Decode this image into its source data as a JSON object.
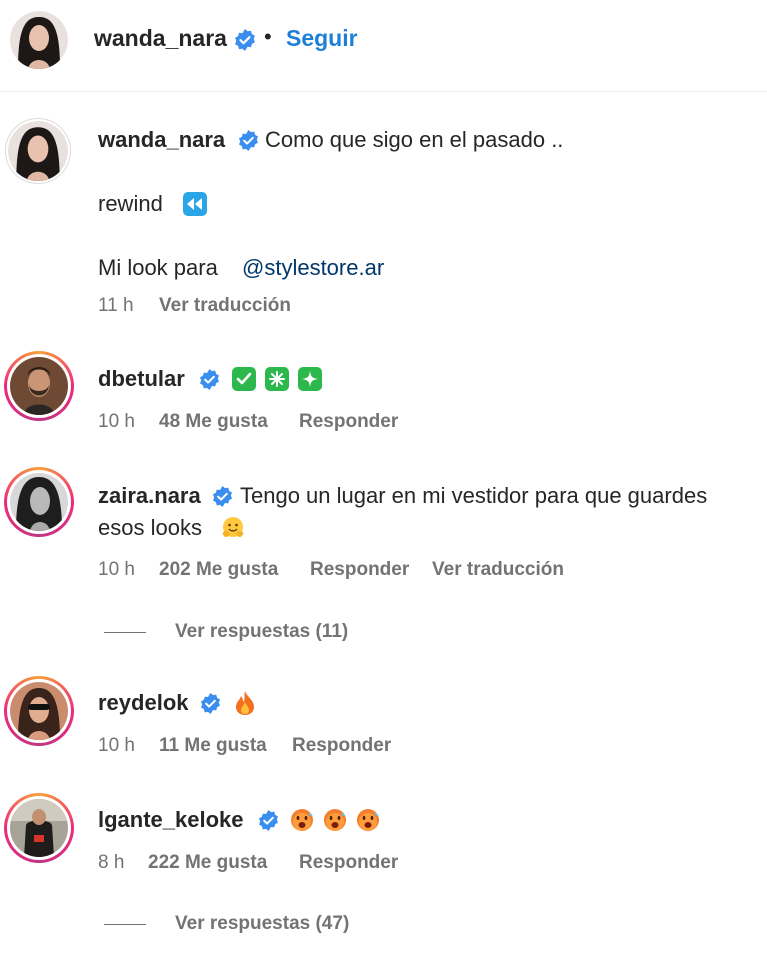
{
  "header": {
    "username": "wanda_nara",
    "separator": "•",
    "follow_label": "Seguir"
  },
  "caption": {
    "username": "wanda_nara",
    "line1": "Como que sigo en el pasado ..",
    "line2": "rewind",
    "line3_prefix": "Mi look para",
    "mention": "@stylestore.ar",
    "time": "11 h",
    "translate": "Ver traducción"
  },
  "comments": [
    {
      "username": "dbetular",
      "text": "",
      "emojis": [
        "check-mark-button",
        "eight-spoked-asterisk",
        "sparkle"
      ],
      "time": "10 h",
      "likes": "48 Me gusta",
      "reply": "Responder"
    },
    {
      "username": "zaira.nara",
      "text_line1": "Tengo un lugar en mi vestidor para que guardes",
      "text_line2": "esos looks",
      "emojis": [
        "hugging-face"
      ],
      "time": "10 h",
      "likes": "202 Me gusta",
      "reply": "Responder",
      "translate": "Ver traducción",
      "view_replies": "Ver respuestas (11)"
    },
    {
      "username": "reydelok",
      "emojis": [
        "fire"
      ],
      "time": "10 h",
      "likes": "11 Me gusta",
      "reply": "Responder"
    },
    {
      "username": "lgante_keloke",
      "emojis": [
        "hot-face",
        "hot-face",
        "hot-face"
      ],
      "time": "8 h",
      "likes": "222 Me gusta",
      "reply": "Responder",
      "view_replies": "Ver respuestas (47)"
    }
  ],
  "colors": {
    "link_blue": "#1e7fd6",
    "verified_blue": "#3a8ef0",
    "mention_blue": "#00376b",
    "muted": "#737373"
  }
}
